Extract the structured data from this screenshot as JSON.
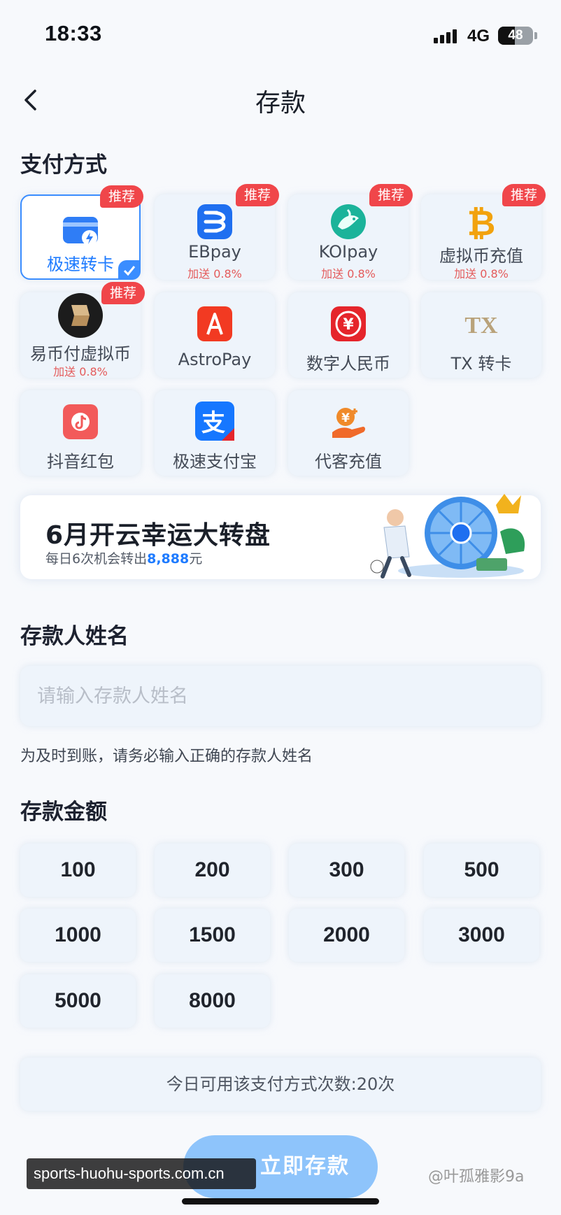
{
  "status_bar": {
    "time": "18:33",
    "network": "4G",
    "battery": "48",
    "battery_level": 0.48
  },
  "header": {
    "title": "存款"
  },
  "payment": {
    "section_title": "支付方式",
    "methods": [
      {
        "label": "极速转卡",
        "bonus": "",
        "badge": "推荐",
        "selected": true,
        "icon": "card-bolt-icon"
      },
      {
        "label": "EBpay",
        "bonus": "加送 0.8%",
        "badge": "推荐",
        "icon": "ebpay-icon"
      },
      {
        "label": "KOIpay",
        "bonus": "加送 0.8%",
        "badge": "推荐",
        "icon": "koi-fish-icon"
      },
      {
        "label": "虚拟币充值",
        "bonus": "加送 0.8%",
        "badge": "推荐",
        "icon": "bitcoin-icon"
      },
      {
        "label": "易币付虚拟币",
        "bonus": "加送 0.8%",
        "badge": "推荐",
        "icon": "yibifu-icon"
      },
      {
        "label": "AstroPay",
        "bonus": "",
        "badge": "",
        "icon": "astropay-icon"
      },
      {
        "label": "数字人民币",
        "bonus": "",
        "badge": "",
        "icon": "digital-rmb-icon"
      },
      {
        "label": "TX 转卡",
        "bonus": "",
        "badge": "",
        "icon": "tx-icon"
      },
      {
        "label": "抖音红包",
        "bonus": "",
        "badge": "",
        "icon": "douyin-redpacket-icon"
      },
      {
        "label": "极速支付宝",
        "bonus": "",
        "badge": "",
        "icon": "alipay-icon"
      },
      {
        "label": "代客充值",
        "bonus": "",
        "badge": "",
        "icon": "agent-recharge-icon"
      }
    ]
  },
  "banner": {
    "title": "6月开云幸运大转盘",
    "subtitle_prefix": "每日6次机会转出",
    "subtitle_amount": "8,888",
    "subtitle_suffix": "元"
  },
  "depositor": {
    "section_title": "存款人姓名",
    "input_placeholder": "请输入存款人姓名",
    "input_value": "",
    "hint": "为及时到账，请务必输入正确的存款人姓名"
  },
  "amount": {
    "section_title": "存款金额",
    "options": [
      "100",
      "200",
      "300",
      "500",
      "1000",
      "1500",
      "2000",
      "3000",
      "5000",
      "8000"
    ]
  },
  "limit_text": "今日可用该支付方式次数:20次",
  "submit_label": "立即存款",
  "watermark": "sports-huohu-sports.com.cn",
  "credit": "@叶孤雅影9a",
  "colors": {
    "accent": "#1e7bff",
    "badge": "#f0464a",
    "card_bg": "#eef4fb",
    "submit": "#8ec4fb"
  }
}
